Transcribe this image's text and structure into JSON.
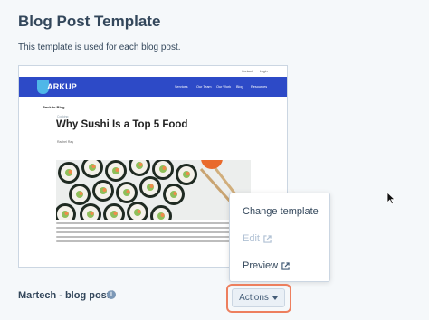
{
  "page": {
    "title": "Blog Post Template",
    "description": "This template is used for each blog post."
  },
  "preview": {
    "utility_links": [
      "Contact",
      "Login"
    ],
    "logo_text": "ARKUP",
    "nav_items": [
      "Services",
      "Our Team",
      "Our Work",
      "Blog",
      "Resources"
    ],
    "back_link": "Back to Blog",
    "category": "Cooking",
    "post_title": "Why Sushi Is a Top 5 Food",
    "author": "Rachel Ray"
  },
  "template": {
    "name": "Martech - blog post",
    "info_icon": "info-icon"
  },
  "actions_menu": {
    "items": [
      {
        "label": "Change template",
        "enabled": true,
        "icon": ""
      },
      {
        "label": "Edit",
        "enabled": false,
        "icon": "external-link-icon"
      },
      {
        "label": "Preview",
        "enabled": true,
        "icon": "external-link-icon"
      }
    ],
    "button_label": "Actions",
    "highlight_color": "#ed7f5e"
  },
  "colors": {
    "nav_bar": "#2d4ac7",
    "text": "#33475b",
    "disabled": "#b0c1d4"
  }
}
